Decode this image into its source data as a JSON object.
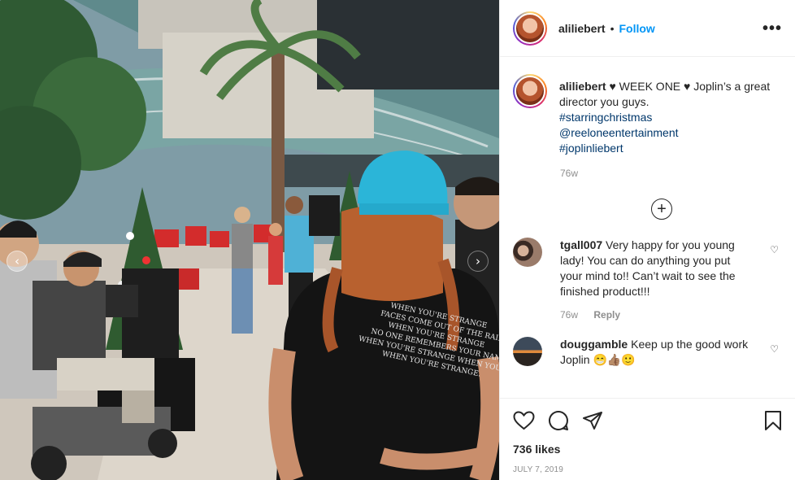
{
  "post": {
    "username": "aliliebert",
    "follow_label": "Follow",
    "header_separator": "•",
    "more_icon": "more-options-icon",
    "more_label": "•••"
  },
  "caption": {
    "username": "aliliebert",
    "text": "♥ WEEK ONE ♥ Joplin’s a great director you guys.",
    "hashtags": [
      "#starringchristmas",
      "@reeloneentertainment",
      "#joplinliebert"
    ],
    "time": "76w"
  },
  "load_more_label": "+",
  "comments": [
    {
      "username": "tgall007",
      "text": "Very happy for you young lady! You can do anything you put your mind to!! Can’t wait to see the finished product!!!",
      "time": "76w",
      "reply_label": "Reply"
    },
    {
      "username": "douggamble",
      "text": "Keep up the good work Joplin 😁👍🏽🙂"
    }
  ],
  "engagement": {
    "likes": "736 likes",
    "date": "JULY 7, 2019"
  },
  "photo": {
    "shirt_lines": [
      "WHEN YOU'RE STRANGE",
      "FACES COME OUT OF THE RAIN",
      "WHEN YOU'RE STRANGE",
      "NO ONE REMEMBERS YOUR NAME",
      "WHEN YOU'RE STRANGE WHEN YOU'RE",
      "WHEN YOU'RE STRANGE."
    ],
    "prev_arrow": "‹",
    "next_arrow": "›"
  },
  "colors": {
    "link": "#0095f6",
    "hashtag": "#00376b",
    "muted": "#8e8e8e",
    "cap": "#2bb5d8"
  }
}
